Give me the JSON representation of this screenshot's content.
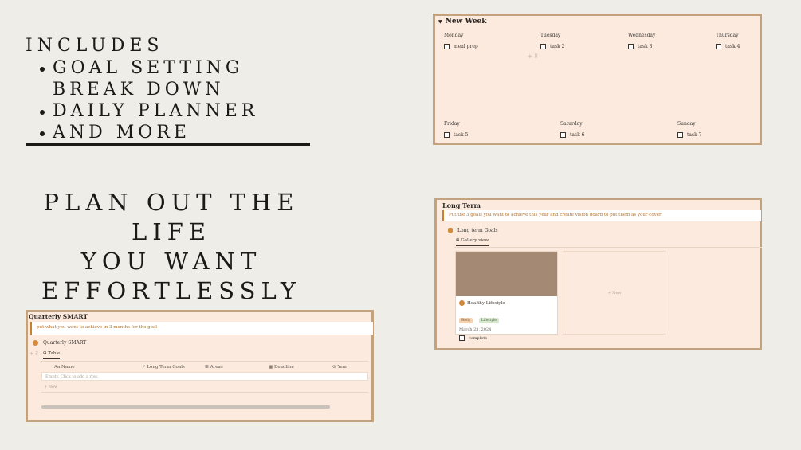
{
  "includes": {
    "title": "Includes",
    "items": [
      {
        "line1": "Goal Setting",
        "line2": "Break Down"
      },
      {
        "line1": "Daily Planner"
      },
      {
        "line1": "And More"
      }
    ]
  },
  "tagline": {
    "line1": "Plan out the life",
    "line2": "you want",
    "line3": "effortlessly"
  },
  "new_week": {
    "title": "New Week",
    "caret": "▼",
    "days": [
      {
        "name": "Monday",
        "task": "meal prep"
      },
      {
        "name": "Tuesday",
        "task": "task 2"
      },
      {
        "name": "Wednesday",
        "task": "task 3"
      },
      {
        "name": "Thursday",
        "task": "task 4"
      },
      {
        "name": "Friday",
        "task": "task 5"
      },
      {
        "name": "Saturday",
        "task": "task 6"
      },
      {
        "name": "Sunday",
        "task": "task 7"
      }
    ],
    "drag_handle": "+ ⠿"
  },
  "long_term": {
    "title": "Long Term",
    "callout": "Put the 3 goals you want to achieve this year and create vision board to put them as your cover",
    "database_title": "Long term Goals",
    "view_tab": "Gallery view",
    "view_icon": "⊞",
    "card": {
      "name": "Healthy Lifestyle",
      "tags": [
        "Body",
        "Lifestyle"
      ],
      "date": "March 23, 2024",
      "checkbox_label": "complete"
    },
    "new_card_label": "+ New",
    "colors": {
      "tag_body": "#f3d3b3",
      "tag_lifestyle": "#d7e8cf",
      "cover": "#a48a75"
    }
  },
  "quarterly": {
    "title": "Quarterly SMART",
    "callout": "put what you want to achieve in 3 months for the goal",
    "database_title": "Quarterly SMART",
    "view_tab": "Table",
    "view_icon": "⊞",
    "columns": [
      {
        "icon": "Aa",
        "label": "Name"
      },
      {
        "icon": "↗",
        "label": "Long Term Goals"
      },
      {
        "icon": "☰",
        "label": "Areas"
      },
      {
        "icon": "▦",
        "label": "Deadline"
      },
      {
        "icon": "⊙",
        "label": "Year"
      }
    ],
    "empty_row": "Empty. Click to add a row.",
    "new_row": "+ New",
    "drag_handle": "+ ⠿"
  }
}
